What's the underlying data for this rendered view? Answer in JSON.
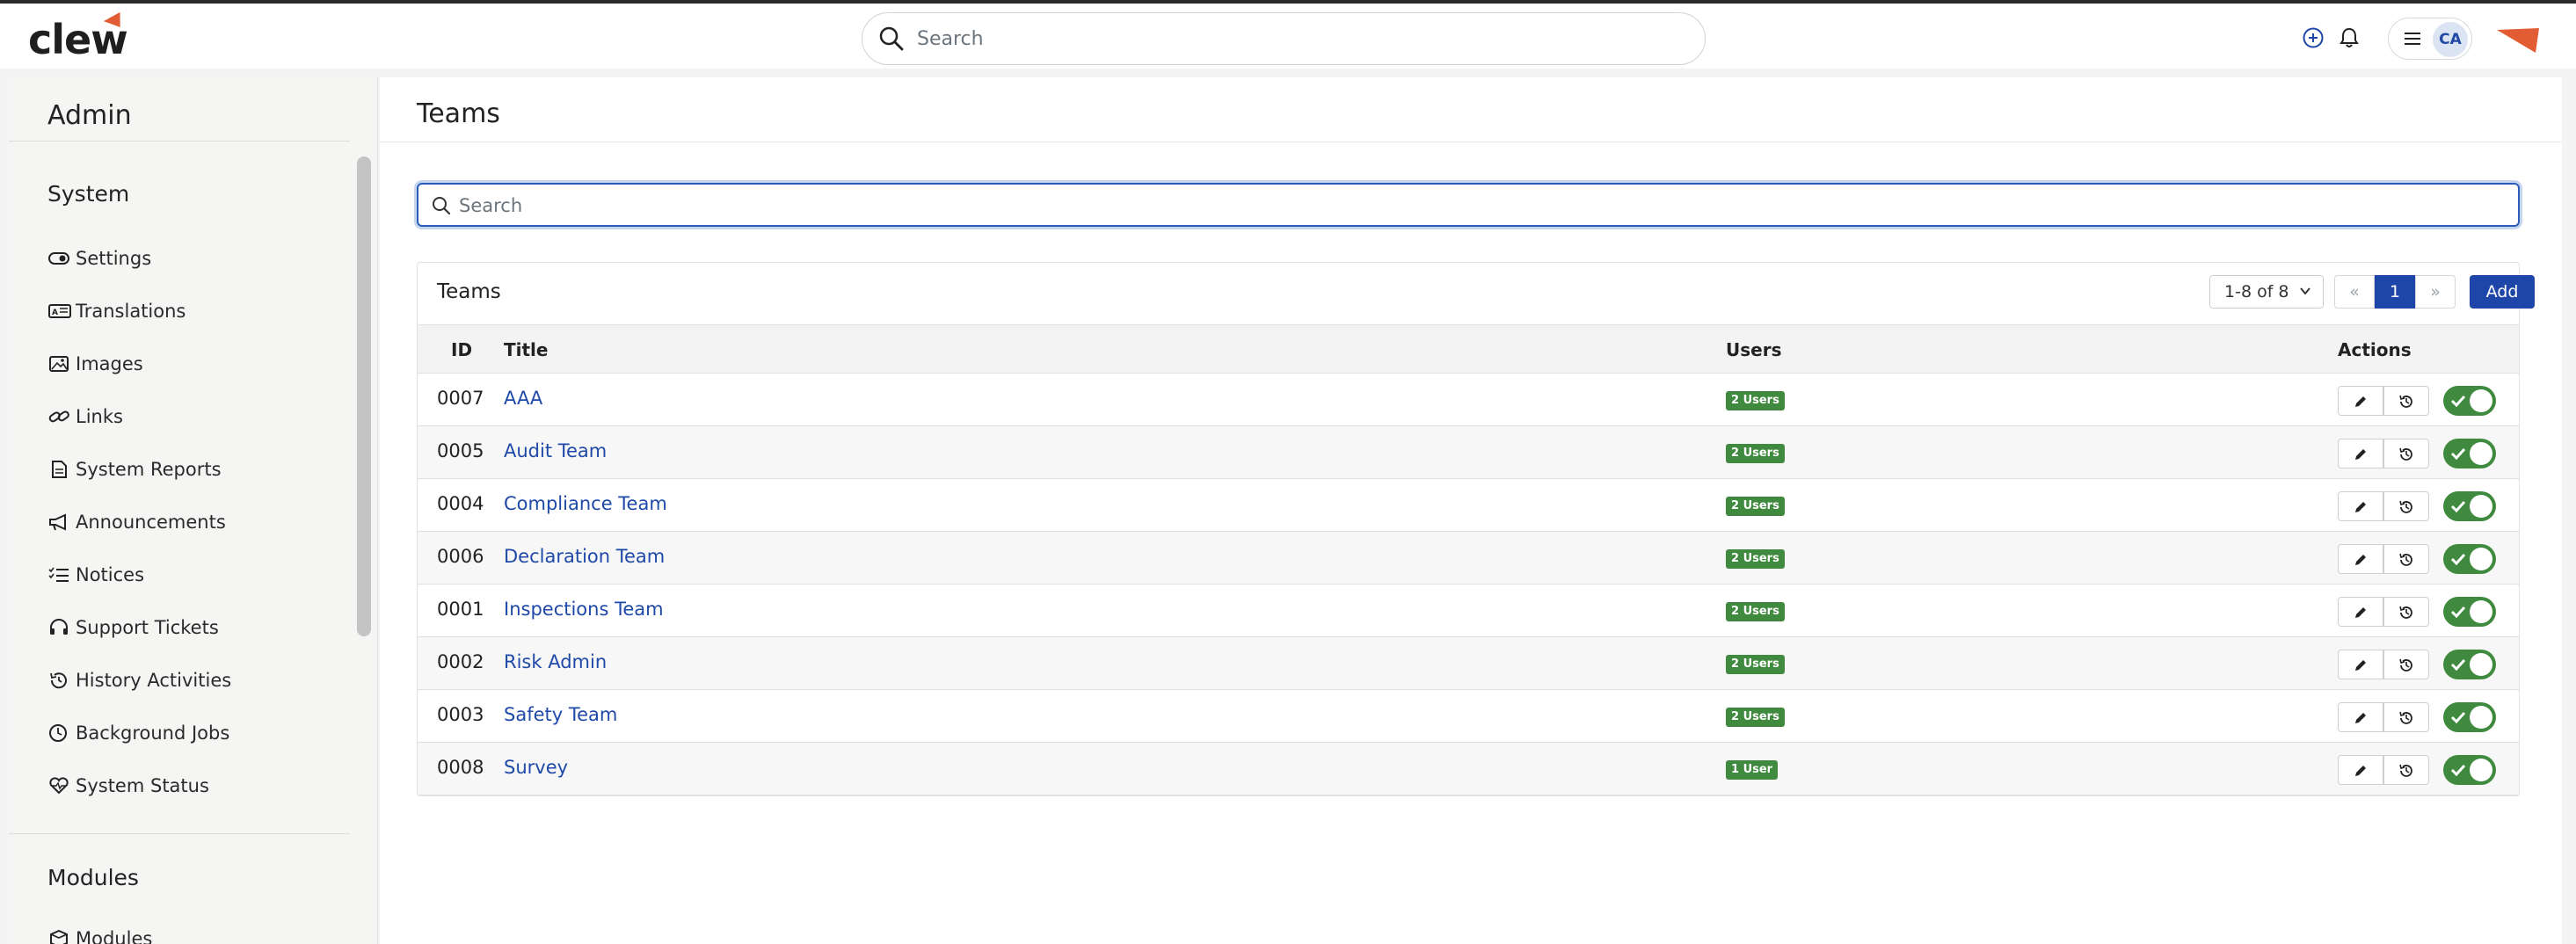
{
  "topbar": {
    "logo": "clew",
    "search_placeholder": "Search",
    "user_initials": "CA"
  },
  "sidebar": {
    "title": "Admin",
    "sections": [
      {
        "title": "System",
        "items": [
          {
            "label": "Settings",
            "icon": "toggle-icon"
          },
          {
            "label": "Translations",
            "icon": "translate-icon"
          },
          {
            "label": "Images",
            "icon": "image-icon"
          },
          {
            "label": "Links",
            "icon": "link-icon"
          },
          {
            "label": "System Reports",
            "icon": "report-icon"
          },
          {
            "label": "Announcements",
            "icon": "megaphone-icon"
          },
          {
            "label": "Notices",
            "icon": "list-check-icon"
          },
          {
            "label": "Support Tickets",
            "icon": "headset-icon"
          },
          {
            "label": "History Activities",
            "icon": "history-icon"
          },
          {
            "label": "Background Jobs",
            "icon": "clock-icon"
          },
          {
            "label": "System Status",
            "icon": "heart-pulse-icon"
          }
        ]
      },
      {
        "title": "Modules",
        "items": [
          {
            "label": "Modules",
            "icon": "box-icon"
          }
        ]
      }
    ]
  },
  "main": {
    "title": "Teams",
    "filter_placeholder": "Search",
    "card": {
      "title": "Teams",
      "range": "1-8 of 8",
      "pagination": {
        "first": "«",
        "current": "1",
        "next": "»"
      },
      "add_label": "Add",
      "columns": {
        "id": "ID",
        "title": "Title",
        "users": "Users",
        "actions": "Actions"
      },
      "rows": [
        {
          "id": "0007",
          "title": "AAA",
          "users": "2 Users",
          "enabled": true
        },
        {
          "id": "0005",
          "title": "Audit Team",
          "users": "2 Users",
          "enabled": true
        },
        {
          "id": "0004",
          "title": "Compliance Team",
          "users": "2 Users",
          "enabled": true
        },
        {
          "id": "0006",
          "title": "Declaration Team",
          "users": "2 Users",
          "enabled": true
        },
        {
          "id": "0001",
          "title": "Inspections Team",
          "users": "2 Users",
          "enabled": true
        },
        {
          "id": "0002",
          "title": "Risk Admin",
          "users": "2 Users",
          "enabled": true
        },
        {
          "id": "0003",
          "title": "Safety Team",
          "users": "2 Users",
          "enabled": true
        },
        {
          "id": "0008",
          "title": "Survey",
          "users": "1 User",
          "enabled": true
        }
      ]
    }
  },
  "colors": {
    "primary": "#1e45a8",
    "success": "#3f8a3f",
    "brand_accent": "#e25d33"
  }
}
